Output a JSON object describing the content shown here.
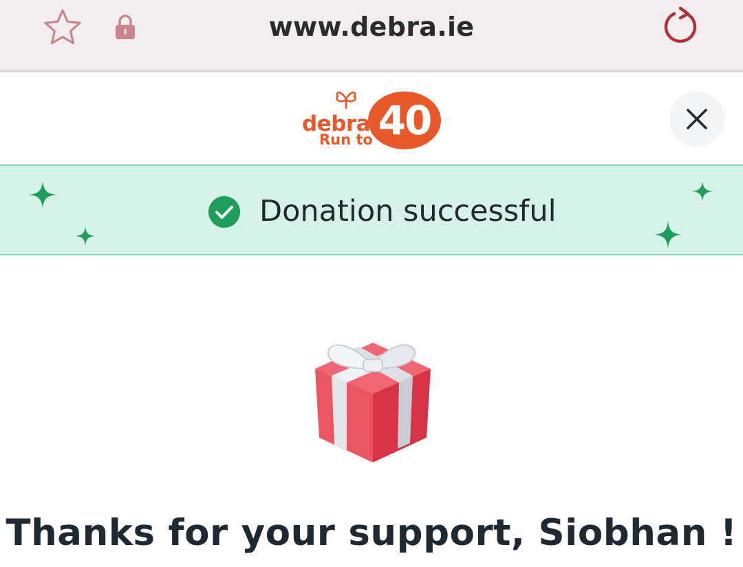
{
  "browser": {
    "url": "www.debra.ie",
    "icons": {
      "bookmark": "star-icon",
      "secure": "lock-icon",
      "reload": "reload-icon"
    },
    "icon_color": "#b44a5a"
  },
  "header": {
    "logo": {
      "brand": "debra",
      "tagline": "Run to",
      "number": "40",
      "color": "#e8592a"
    },
    "close_icon": "close-icon"
  },
  "banner": {
    "message": "Donation successful",
    "background": "#d6f2e8",
    "accent": "#1e9e5a"
  },
  "main": {
    "illustration": "gift-icon",
    "title": "Thanks for your support, Siobhan !"
  }
}
